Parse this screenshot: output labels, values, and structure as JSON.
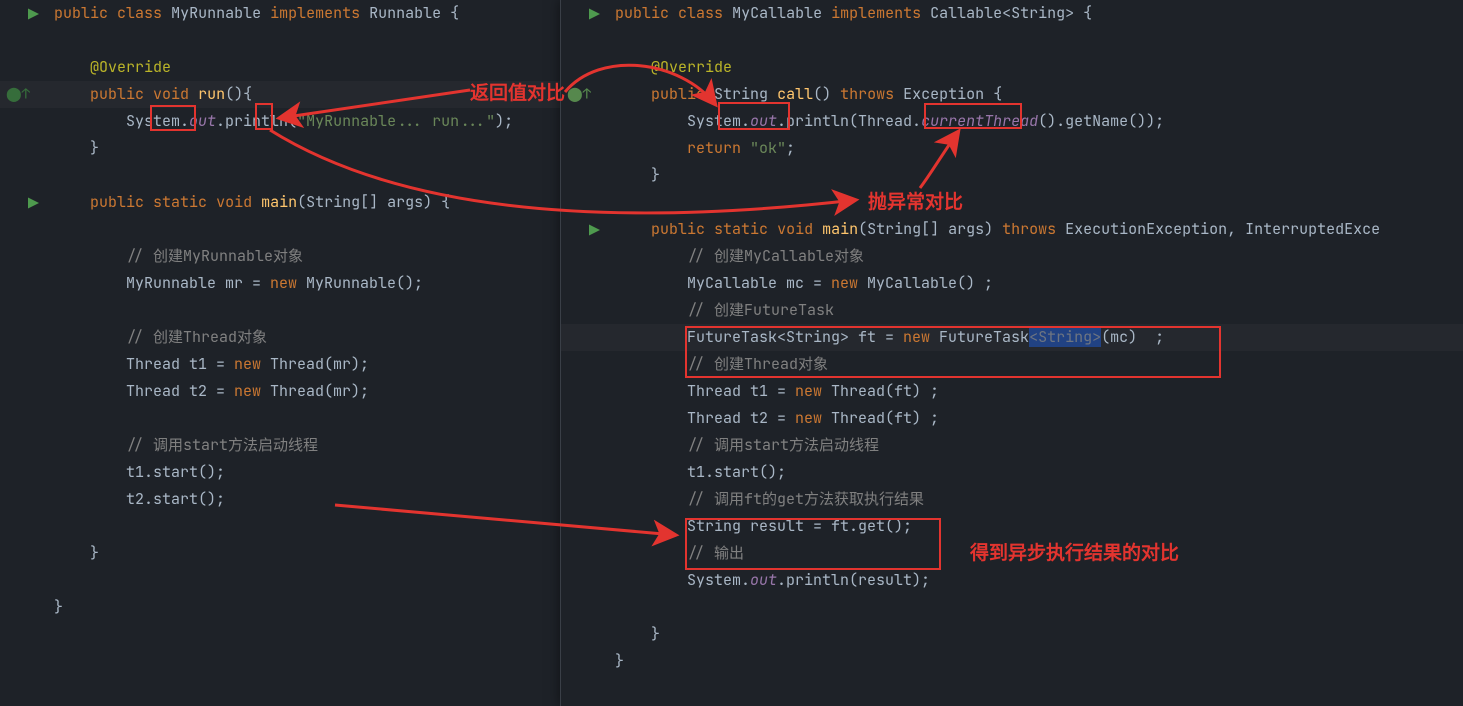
{
  "annotations": {
    "ret": "返回值对比",
    "exc": "抛异常对比",
    "res": "得到异步执行结果的对比"
  },
  "tokens": {
    "public": "public",
    "class": "class",
    "implements": "implements",
    "void": "void",
    "static": "static",
    "new": "new",
    "throws": "throws",
    "return": "return"
  },
  "left": {
    "class_name": "MyRunnable",
    "iface": "Runnable",
    "ann": "@Override",
    "ret": "void",
    "m1": "run",
    "m1_body": "System.",
    "out": "out",
    "ln1": ".println(",
    "s1": "\"MyRunnable... run...\"",
    "tail1": ");",
    "main": "main",
    "main_args": "(String[] args) {",
    "c1": "// 创建MyRunnable对象",
    "l1a": "MyRunnable mr = ",
    "l1b": "new",
    "l1c": " MyRunnable();",
    "c2": "// 创建Thread对象",
    "l2a": "Thread t1 = ",
    "l2c": " Thread(mr);",
    "l3a": "Thread t2 = ",
    "l3c": " Thread(mr);",
    "c3": "// 调用start方法启动线程",
    "l4": "t1.start();",
    "l5": "t2.start();"
  },
  "right": {
    "class_name": "MyCallable",
    "iface": "Callable",
    "iface_g": "<String>",
    "ann": "@Override",
    "ret": "String",
    "m1": "call",
    "throws": "throws",
    "exc": "Exception",
    "body1_a": "System.",
    "out": "out",
    "body1_b": ".println(Thread.",
    "cur": "currentThread",
    "body1_c": "().getName());",
    "retln": "return ",
    "rets": "\"ok\"",
    "rettail": ";",
    "main": "main",
    "main_args": "(String[] args) ",
    "main_throws": "throws",
    "main_exc": " ExecutionException, InterruptedExce",
    "c1": "// 创建MyCallable对象",
    "r1a": "MyCallable mc = ",
    "r1c": " MyCallable() ;",
    "c2": "// 创建FutureTask",
    "r2a": "FutureTask<String> ft = ",
    "r2c": " FutureTask",
    "r2g": "<String>",
    "r2d": "(mc)  ;",
    "c3": "// 创建Thread对象",
    "r3a": "Thread t1 = ",
    "r3c": " Thread(ft) ;",
    "r4a": "Thread t2 = ",
    "r4c": " Thread(ft) ;",
    "c4": "// 调用start方法启动线程",
    "r5": "t1.start();",
    "c5": "// 调用ft的get方法获取执行结果",
    "r6": "String result = ft.get();",
    "c6": "// 输出",
    "r7a": "System.",
    "r7b": ".println(result);"
  },
  "colors": {
    "red": "#e3342f"
  }
}
